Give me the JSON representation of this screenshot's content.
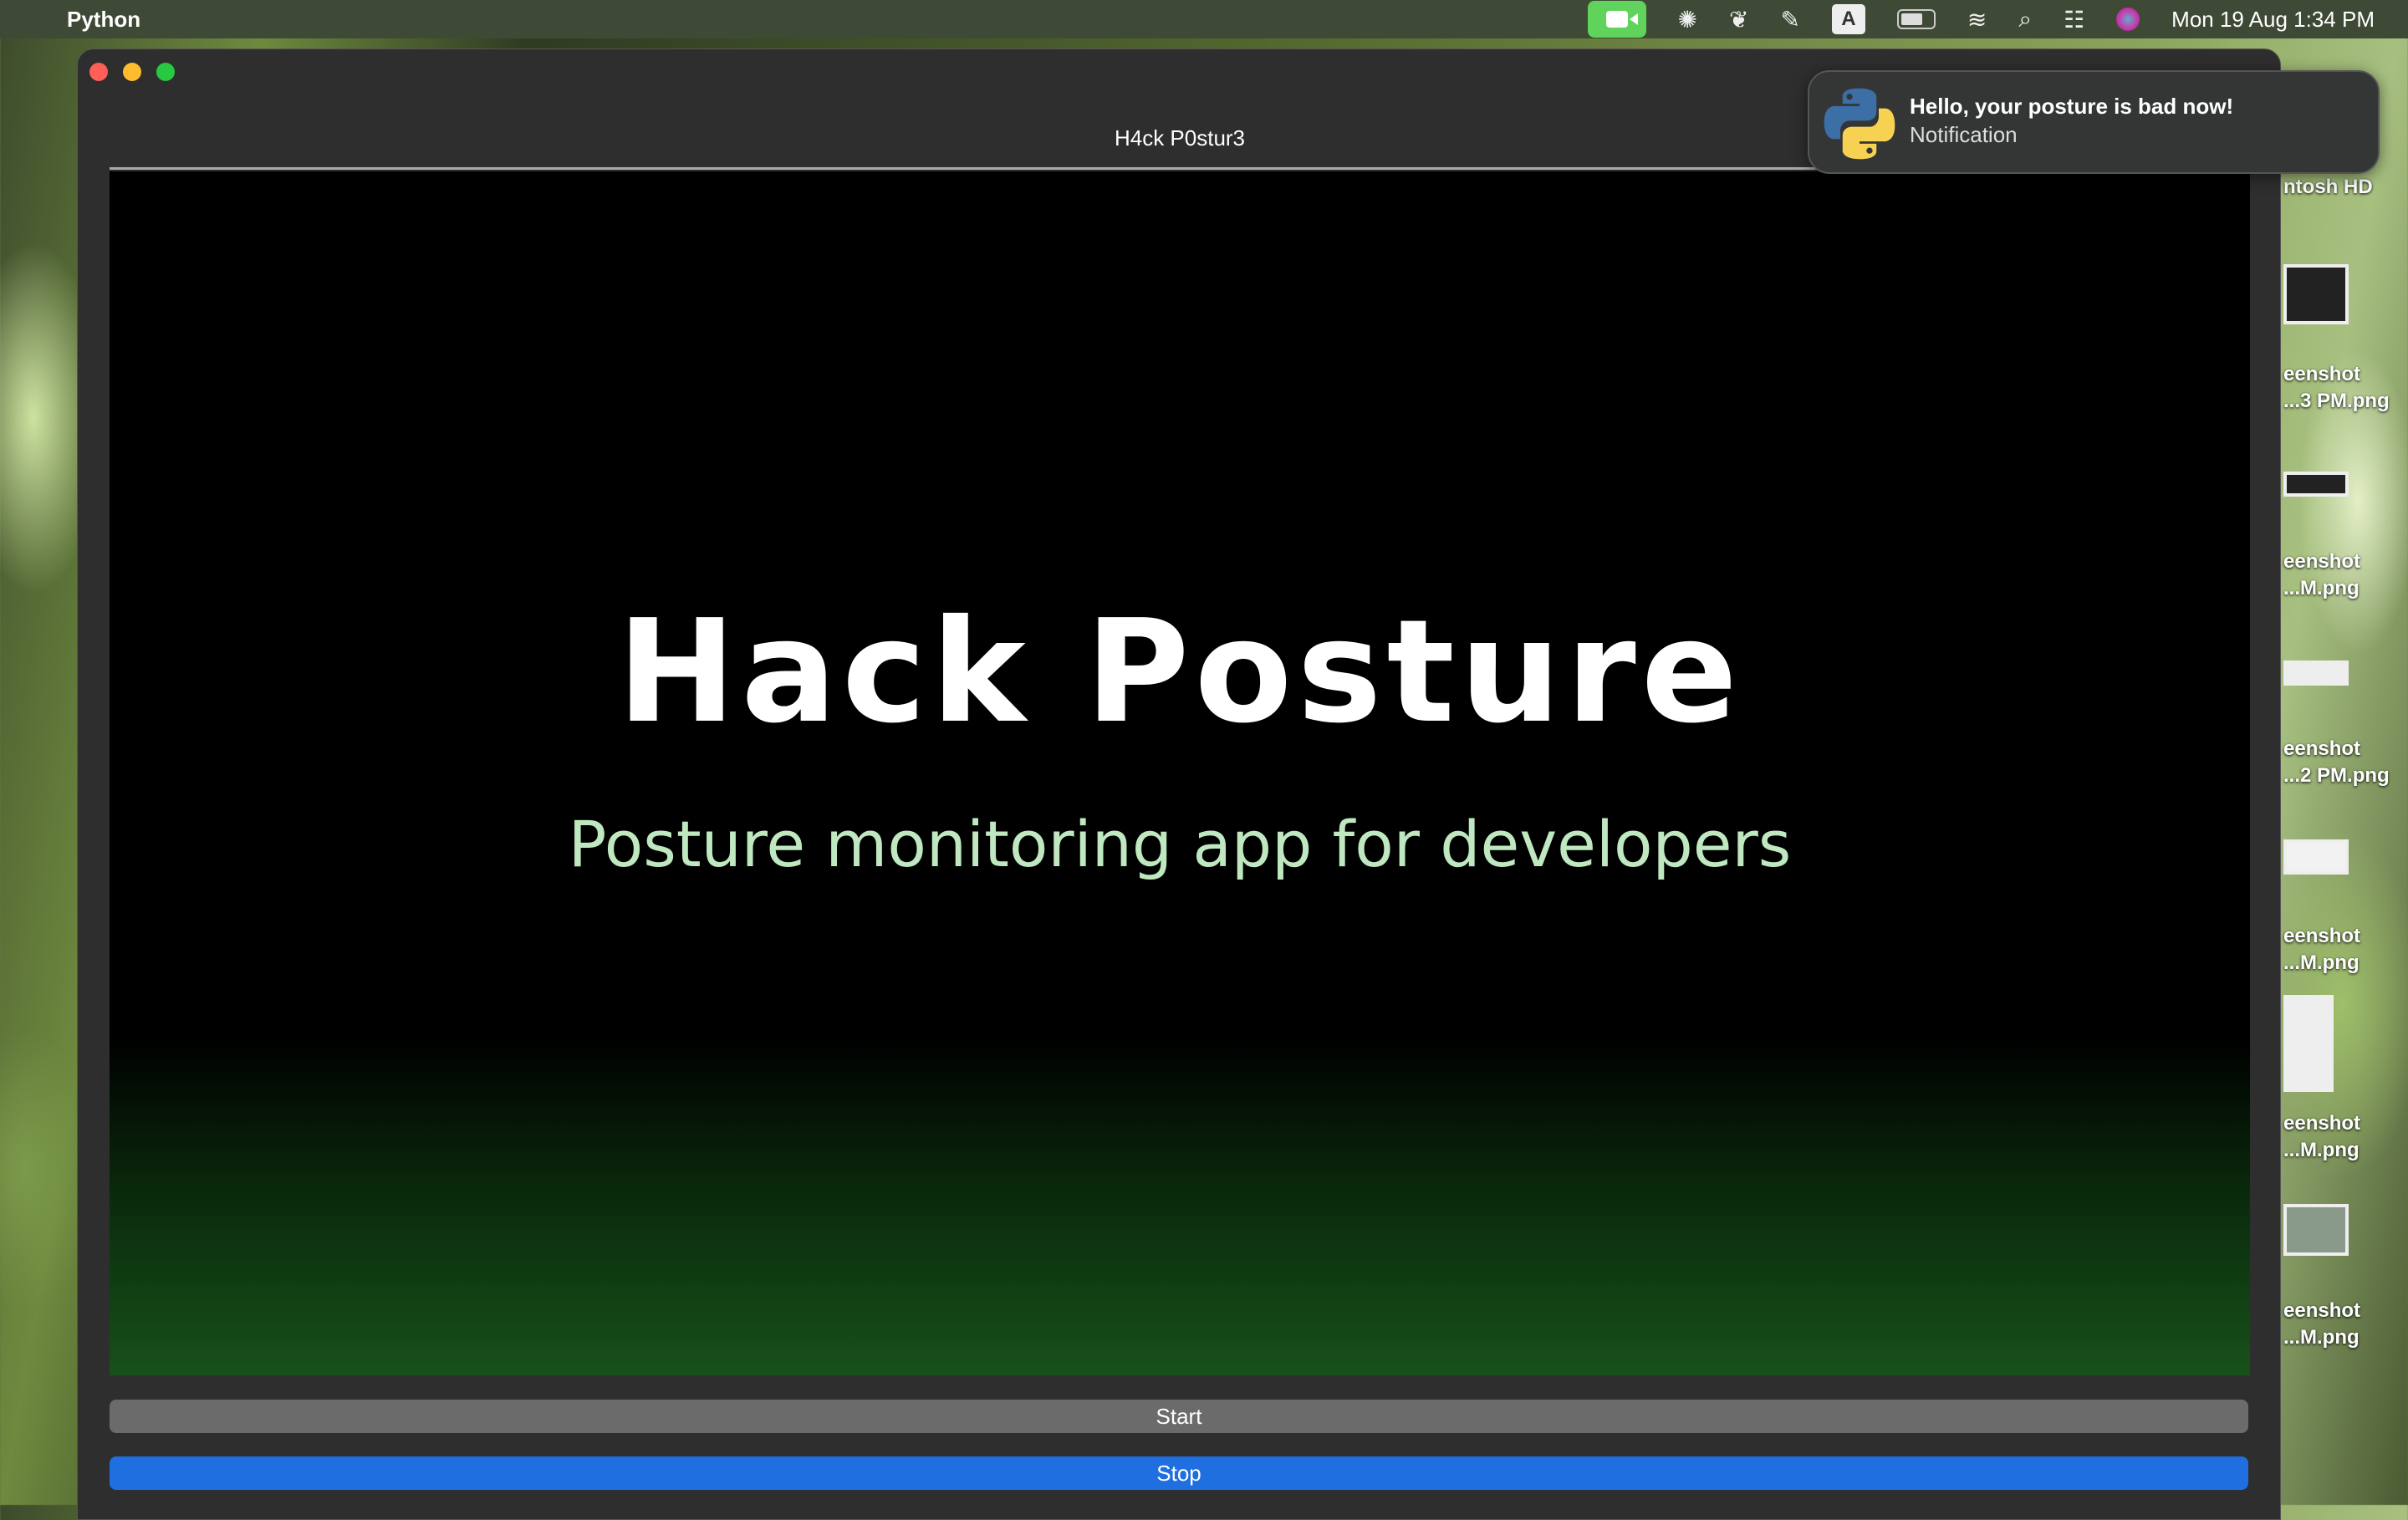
{
  "menubar": {
    "app_name": "Python",
    "datetime": "Mon 19 Aug  1:34 PM",
    "input_source": "A",
    "icons": [
      "apple-icon",
      "facetime-icon",
      "chatgpt-icon",
      "docker-icon",
      "scrivener-icon",
      "input-source-icon",
      "battery-icon",
      "wifi-icon",
      "spotlight-icon",
      "control-center-icon",
      "siri-icon"
    ]
  },
  "window": {
    "title": "H4ck P0stur3",
    "heading": "Hack Posture",
    "subtitle": "Posture monitoring app for developers",
    "start_label": "Start",
    "stop_label": "Stop"
  },
  "notification": {
    "title": "Hello, your posture is bad now!",
    "body": "Notification"
  },
  "desktop": {
    "items": [
      {
        "line1": "ntosh HD",
        "line2": ""
      },
      {
        "line1": "eenshot",
        "line2": "...3 PM.png"
      },
      {
        "line1": "eenshot",
        "line2": "...M.png"
      },
      {
        "line1": "eenshot",
        "line2": "...2 PM.png"
      },
      {
        "line1": "eenshot",
        "line2": "...M.png"
      },
      {
        "line1": "eenshot",
        "line2": "...M.png"
      },
      {
        "line1": "eenshot",
        "line2": "...M.png"
      }
    ]
  }
}
